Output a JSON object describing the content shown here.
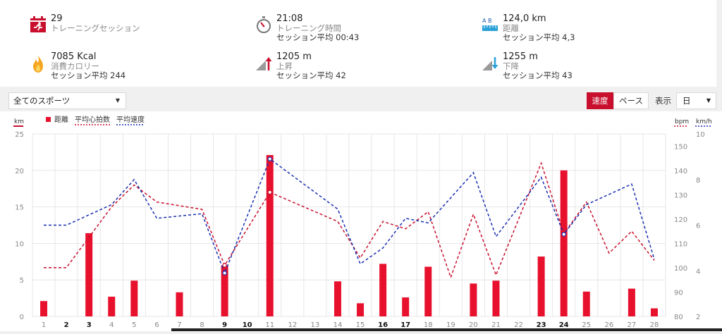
{
  "stats": {
    "sessions": {
      "value": "29",
      "label": "トレーニングセッション"
    },
    "time": {
      "value": "21:08",
      "label": "トレーニング時間",
      "avg": "セッション平均 00:43"
    },
    "distance": {
      "value": "124,0 km",
      "label": "距離",
      "avg": "セッション平均 4,3",
      "icon_letters": "A B"
    },
    "calories": {
      "value": "7085 Kcal",
      "label": "消費カロリー",
      "avg": "セッション平均 244"
    },
    "ascent": {
      "value": "1205 m",
      "label": "上昇",
      "avg": "セッション平均 42"
    },
    "descent": {
      "value": "1255 m",
      "label": "下降",
      "avg": "セッション平均 43"
    }
  },
  "icons": {
    "sessions": "runner-calendar-icon",
    "time": "stopwatch-icon",
    "distance": "ruler-ab-icon",
    "calories": "flame-icon",
    "ascent": "ascent-arrow-icon",
    "descent": "descent-arrow-icon"
  },
  "filters": {
    "sport": "全てのスポーツ",
    "speed": "速度",
    "pace": "ペース",
    "show_label": "表示",
    "period": "日"
  },
  "colors": {
    "accent": "#c8102e",
    "bar": "#e8112d",
    "hr_line": "#c8102e",
    "speed_line": "#1a2fb0",
    "grid": "#e6e6e6"
  },
  "chart_data": {
    "type": "bar",
    "legend": {
      "distance": "距離",
      "hr": "平均心拍数",
      "speed": "平均速度"
    },
    "units": {
      "left": "km",
      "right_hr": "bpm",
      "right_speed": "km/h"
    },
    "x": [
      "1",
      "2",
      "3",
      "4",
      "5",
      "6",
      "7",
      "8",
      "9",
      "10",
      "11",
      "12",
      "13",
      "14",
      "15",
      "16",
      "17",
      "18",
      "19",
      "20",
      "21",
      "22",
      "23",
      "24",
      "25",
      "26",
      "27",
      "28"
    ],
    "x_bold": [
      "2",
      "3",
      "9",
      "10",
      "16",
      "17",
      "23",
      "24"
    ],
    "distance_km": [
      2.1,
      0,
      11.4,
      2.7,
      4.9,
      0,
      3.3,
      0,
      7.0,
      0,
      22.1,
      0,
      0,
      4.8,
      1.8,
      7.2,
      2.6,
      6.8,
      0,
      4.5,
      4.9,
      0,
      8.2,
      20.0,
      3.4,
      0,
      3.8,
      1.1
    ],
    "avg_hr_bpm": [
      100,
      100,
      null,
      125,
      134,
      127,
      null,
      124,
      101,
      null,
      131,
      null,
      null,
      119,
      104,
      119,
      116,
      123,
      96,
      122,
      97,
      null,
      143,
      114,
      127,
      106,
      115,
      103
    ],
    "avg_speed_kmh": [
      6.0,
      6.0,
      null,
      6.9,
      8.0,
      6.3,
      null,
      6.5,
      3.9,
      null,
      8.9,
      null,
      null,
      6.7,
      4.3,
      5.0,
      6.3,
      6.1,
      null,
      8.3,
      5.5,
      null,
      8.1,
      5.6,
      6.9,
      null,
      7.8,
      4.5
    ],
    "y_left": {
      "min": 0,
      "max": 25,
      "ticks": [
        0,
        5,
        10,
        15,
        20,
        25
      ]
    },
    "y_hr": {
      "min": 80,
      "max": 155,
      "ticks": [
        80,
        90,
        100,
        110,
        120,
        130,
        140,
        150
      ]
    },
    "y_speed": {
      "min": 2,
      "max": 10,
      "ticks": [
        2,
        4,
        6,
        8,
        10
      ]
    },
    "markers": [
      9,
      11,
      24
    ]
  }
}
